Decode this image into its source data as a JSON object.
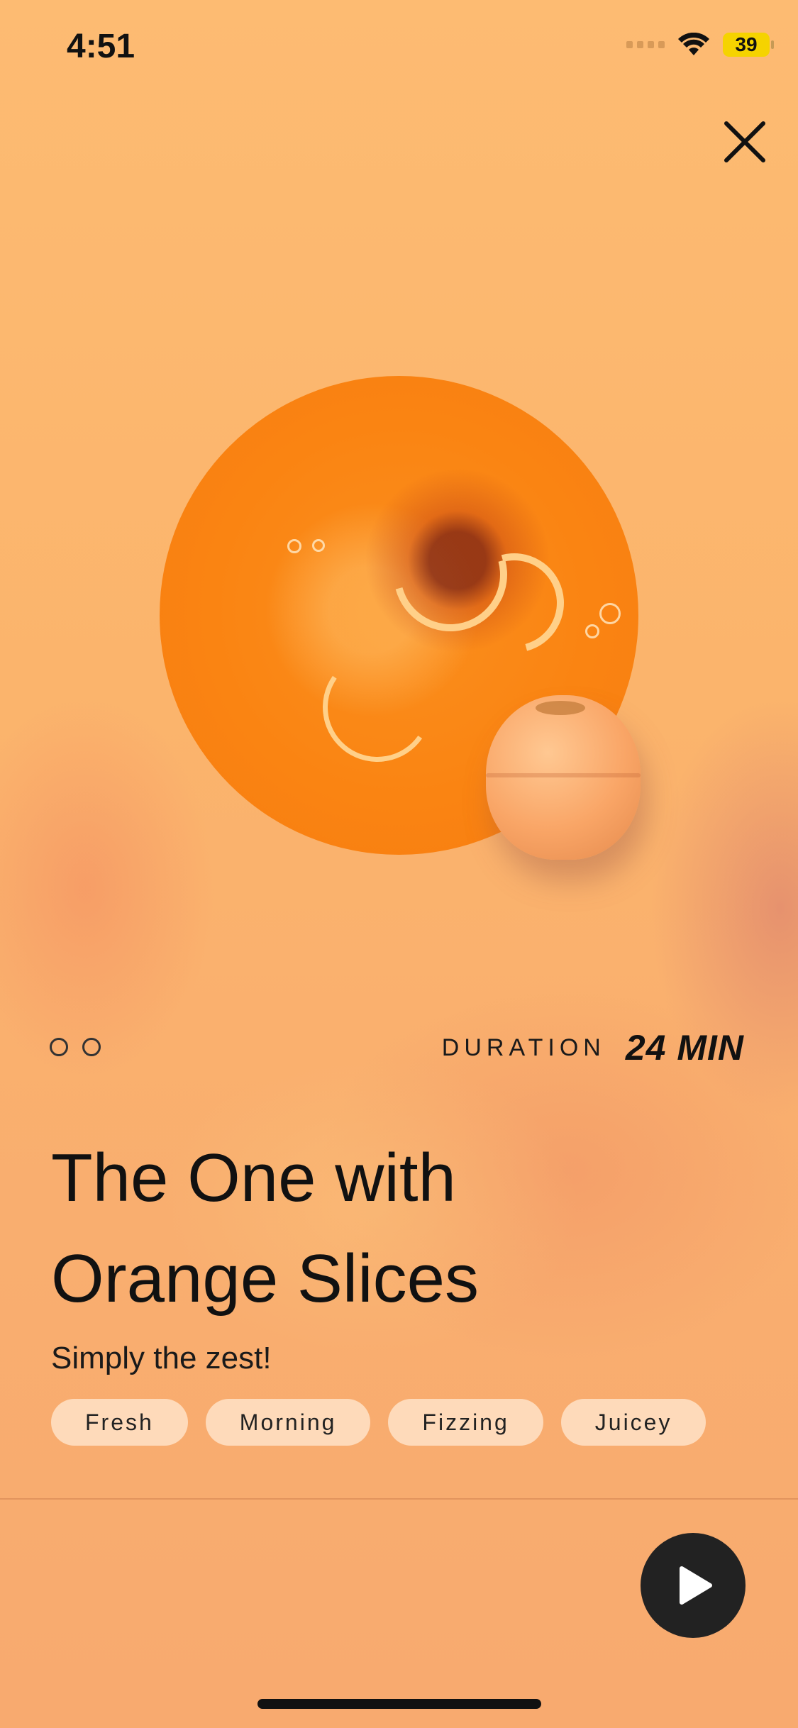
{
  "status_bar": {
    "time": "4:51",
    "battery": "39"
  },
  "hero": {
    "image": "orange-bath-water-with-orange-slices",
    "product": "orange-bath-bomb"
  },
  "pager": {
    "count": 2,
    "active_index": 0
  },
  "duration": {
    "label": "DURATION",
    "value": "24 MIN"
  },
  "title": {
    "line1": "The One with",
    "line2": "Orange Slices"
  },
  "subtitle": "Simply the zest!",
  "tags": [
    "Fresh",
    "Morning",
    "Fizzing",
    "Juicey"
  ],
  "icons": {
    "close": "close-icon",
    "play": "play-icon",
    "wifi": "wifi-icon",
    "battery": "battery-icon"
  },
  "colors": {
    "background": "#fbb66c",
    "hero_orange": "#fa8412",
    "play_button": "#222222",
    "tag_bg": "#ffe6cd"
  }
}
